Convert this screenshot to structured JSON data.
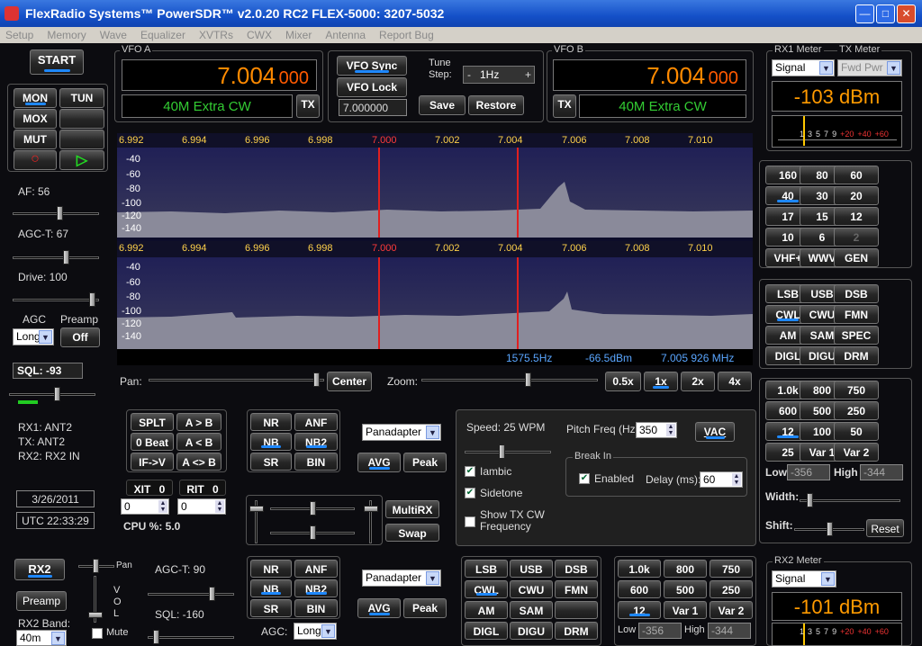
{
  "window": {
    "title": "FlexRadio Systems™  PowerSDR™  v2.0.20  RC2   FLEX-5000:  3207-5032",
    "minimize": "—",
    "maximize": "□",
    "close": "✕"
  },
  "menu": [
    "Setup",
    "Memory",
    "Wave",
    "Equalizer",
    "XVTRs",
    "CWX",
    "Mixer",
    "Antenna",
    "Report Bug"
  ],
  "start_label": "START",
  "vfoa": {
    "title": "VFO A",
    "freq_main": "7.004",
    "freq_sub": "000",
    "band": "40M Extra CW",
    "tx": "TX"
  },
  "vfob": {
    "title": "VFO B",
    "freq_main": "7.004",
    "freq_sub": "000",
    "band": "40M Extra CW",
    "tx": "TX"
  },
  "vfo_mid": {
    "sync": "VFO Sync",
    "lock": "VFO Lock",
    "tune_step_label": "Tune\nStep:",
    "tune_step": "1Hz",
    "minus": "-",
    "plus": "+",
    "freq_input": "7.000000",
    "save": "Save",
    "restore": "Restore"
  },
  "rx1meter": {
    "title": "RX1 Meter",
    "tx_title": "TX Meter",
    "mode": "Signal",
    "tx_mode": "Fwd Pwr",
    "value": "-103 dBm",
    "scale": [
      "1",
      "3",
      "5",
      "7",
      "9",
      "+20",
      "+40",
      "+60"
    ]
  },
  "rx2meter": {
    "title": "RX2 Meter",
    "mode": "Signal",
    "value": "-101 dBm",
    "scale": [
      "1",
      "3",
      "5",
      "7",
      "9",
      "+20",
      "+40",
      "+60"
    ]
  },
  "left": {
    "mon": "MON",
    "tun": "TUN",
    "mox": "MOX",
    "mut": "MUT",
    "rec": "○",
    "play": "▷",
    "af": "AF:  56",
    "agct": "AGC-T:  67",
    "drive": "Drive:  100",
    "agc": "AGC",
    "preamp": "Preamp",
    "agc_val": "Long",
    "preamp_val": "Off",
    "sql": "SQL:  -93",
    "rx1": "RX1: ANT2",
    "tx": "TX: ANT2",
    "rx2": "RX2: RX2 IN",
    "date": "3/26/2011",
    "utc": "UTC 22:33:29"
  },
  "spectrum": {
    "ticks": [
      "6.992",
      "6.994",
      "6.996",
      "6.998",
      "7.000",
      "7.002",
      "7.004",
      "7.006",
      "7.008",
      "7.010"
    ],
    "db": [
      "-40",
      "-60",
      "-80",
      "-100",
      "-120",
      "-140"
    ],
    "db2": [
      "-40",
      "-60",
      "-80",
      "-100",
      "-120",
      "-140"
    ],
    "status_hz": "1575.5Hz",
    "status_dbm": "-66.5dBm",
    "status_mhz": "7.005 926 MHz"
  },
  "pan": {
    "label": "Pan:",
    "center": "Center",
    "zoom_label": "Zoom:",
    "z05": "0.5x",
    "z1": "1x",
    "z2": "2x",
    "z4": "4x"
  },
  "bands": [
    "160",
    "80",
    "60",
    "40",
    "30",
    "20",
    "17",
    "15",
    "12",
    "10",
    "6",
    "2",
    "VHF+",
    "WWV",
    "GEN"
  ],
  "modes": [
    "LSB",
    "USB",
    "DSB",
    "CWL",
    "CWU",
    "FMN",
    "AM",
    "SAM",
    "SPEC",
    "DIGL",
    "DIGU",
    "DRM"
  ],
  "filters": [
    "1.0k",
    "800",
    "750",
    "600",
    "500",
    "250",
    "12",
    "100",
    "50",
    "25",
    "Var 1",
    "Var 2"
  ],
  "filter_ctrl": {
    "low_label": "Low",
    "low": "-356",
    "high_label": "High",
    "high": "-344",
    "width": "Width:",
    "shift": "Shift:",
    "reset": "Reset"
  },
  "dsp1": {
    "splt": "SPLT",
    "atob": "A > B",
    "zerobeat": "0 Beat",
    "altb": "A < B",
    "ifv": "IF->V",
    "aswap": "A <> B",
    "nr": "NR",
    "anf": "ANF",
    "nb": "NB",
    "nb2": "NB2",
    "sr": "SR",
    "bin": "BIN",
    "display": "Panadapter",
    "avg": "AVG",
    "peak": "Peak",
    "xit": "XIT",
    "xit_v": "0",
    "rit": "RIT",
    "rit_v": "0",
    "xit_in": "0",
    "rit_in": "0",
    "cpu": "CPU %: 5.0",
    "multirx": "MultiRX",
    "swap": "Swap"
  },
  "cw": {
    "speed": "Speed:  25 WPM",
    "pitch_label": "Pitch Freq (Hz):",
    "pitch": "350",
    "vac": "VAC",
    "iambic": "Iambic",
    "sidetone": "Sidetone",
    "showtx": "Show TX CW\nFrequency",
    "breakin": "Break In",
    "enabled": "Enabled",
    "delay_label": "Delay (ms):",
    "delay": "60"
  },
  "rx2": {
    "rx2": "RX2",
    "preamp": "Preamp",
    "band_label": "RX2 Band:",
    "band": "40m",
    "pan": "Pan",
    "vol": "V\nO\nL",
    "mute": "Mute",
    "agct": "AGC-T:  90",
    "sql": "SQL:  -160",
    "nr": "NR",
    "anf": "ANF",
    "nb": "NB",
    "nb2": "NB2",
    "sr": "SR",
    "bin": "BIN",
    "agc_label": "AGC:",
    "agc": "Long",
    "display": "Panadapter",
    "avg": "AVG",
    "peak": "Peak",
    "low_label": "Low",
    "low": "-356",
    "high_label": "High",
    "high": "-344"
  },
  "rx2modes": [
    "LSB",
    "USB",
    "DSB",
    "CWL",
    "CWU",
    "FMN",
    "AM",
    "SAM",
    "",
    "DIGL",
    "DIGU",
    "DRM"
  ],
  "rx2filters": [
    "1.0k",
    "800",
    "750",
    "600",
    "500",
    "250",
    "12",
    "Var 1",
    "Var 2"
  ]
}
